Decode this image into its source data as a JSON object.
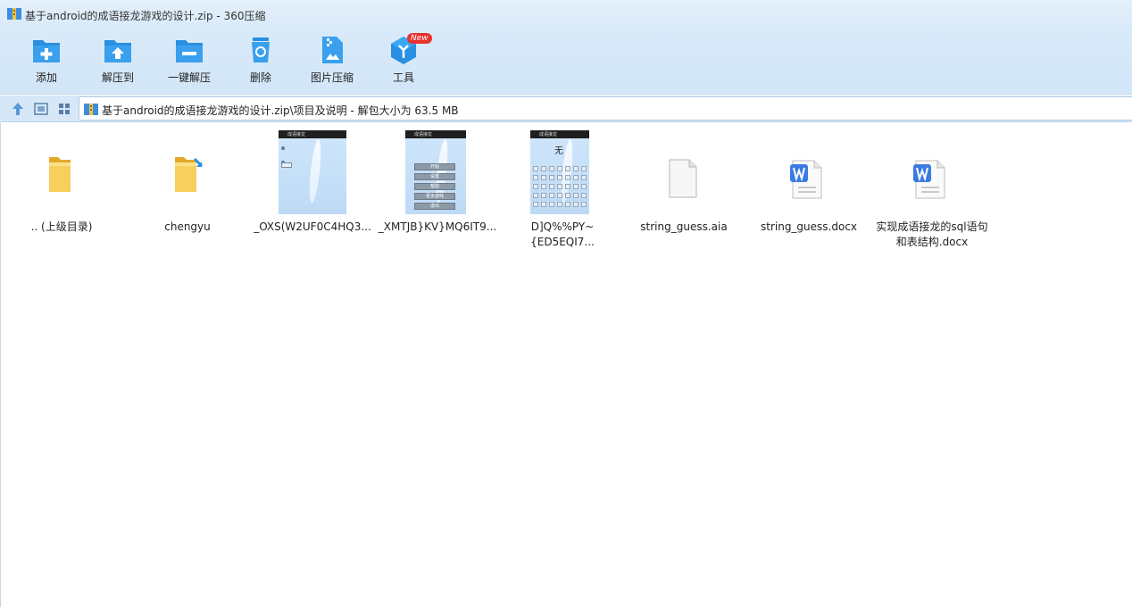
{
  "window": {
    "title": "基于android的成语接龙游戏的设计.zip - 360压缩",
    "app_icon": "archive-app-icon"
  },
  "toolbar": {
    "items": [
      {
        "label": "添加",
        "icon": "add-folder-icon"
      },
      {
        "label": "解压到",
        "icon": "extract-to-icon"
      },
      {
        "label": "一键解压",
        "icon": "one-click-extract-icon"
      },
      {
        "label": "删除",
        "icon": "recycle-bin-icon"
      },
      {
        "label": "图片压缩",
        "icon": "image-compress-icon"
      },
      {
        "label": "工具",
        "icon": "tools-cube-icon",
        "badge": "New"
      }
    ]
  },
  "addressbar": {
    "path": "基于android的成语接龙游戏的设计.zip\\项目及说明 - 解包大小为 63.5 MB",
    "buttons": [
      "up-arrow-icon",
      "details-view-icon",
      "grid-view-icon"
    ]
  },
  "files": [
    {
      "name": ".. (上级目录)",
      "type": "parent-folder"
    },
    {
      "name": "chengyu",
      "type": "folder-shortcut"
    },
    {
      "name": "_OXS(W2UF0C4HQ3...",
      "type": "image"
    },
    {
      "name": "_XMTJB}KV}MQ6IT9...",
      "type": "image"
    },
    {
      "name": "D]Q%%PY~{ED5EQI7...",
      "type": "image"
    },
    {
      "name": "string_guess.aia",
      "type": "file"
    },
    {
      "name": "string_guess.docx",
      "type": "docx"
    },
    {
      "name": "实现成语接龙的sql语句和表结构.docx",
      "type": "docx"
    }
  ],
  "thumbnails": {
    "app_title": "成语接龙",
    "menu_buttons": [
      "开始",
      "设置",
      "帮助",
      "更多游戏",
      "退出"
    ],
    "settings_button": "确定",
    "game_char": "无"
  },
  "colors": {
    "titlebar": "#e4f0fb",
    "toolbar": "#d6e8f8",
    "icon_blue": "#2a8fe0",
    "badge_red": "#e8312d",
    "folder_yellow": "#f2c24f",
    "word_blue": "#3b7be0"
  }
}
